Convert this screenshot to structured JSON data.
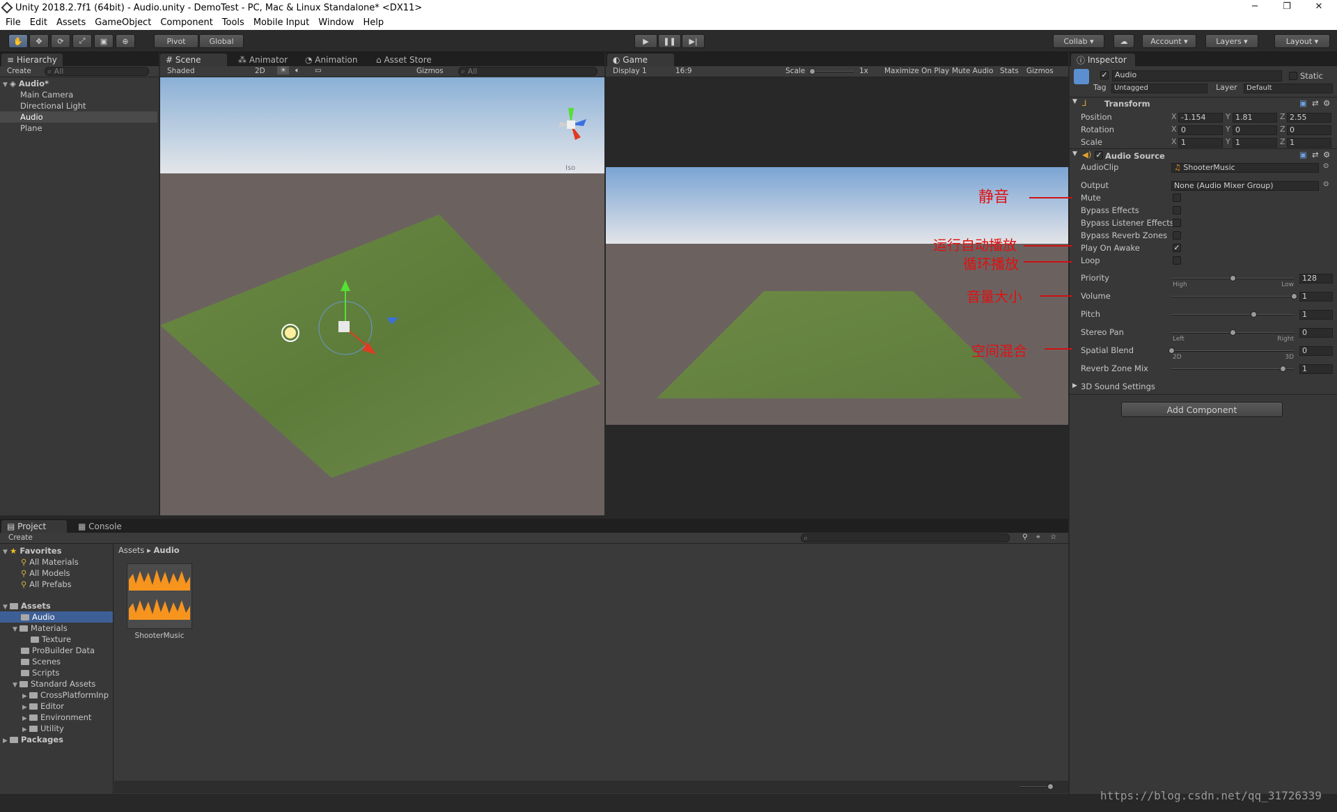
{
  "window": {
    "title": "Unity 2018.2.7f1 (64bit) - Audio.unity - DemoTest - PC, Mac & Linux Standalone* <DX11>",
    "minimize": "─",
    "restore": "❐",
    "close": "✕"
  },
  "menu": [
    "File",
    "Edit",
    "Assets",
    "GameObject",
    "Component",
    "Tools",
    "Mobile Input",
    "Window",
    "Help"
  ],
  "toolbar": {
    "pivot": "Pivot",
    "global": "Global",
    "collab": "Collab",
    "account": "Account",
    "layers": "Layers",
    "layout": "Layout"
  },
  "hierarchy": {
    "tab": "Hierarchy",
    "create": "Create",
    "search_placeholder": "All",
    "scene": "Audio*",
    "items": [
      "Main Camera",
      "Directional Light",
      "Audio",
      "Plane"
    ]
  },
  "scene": {
    "tabs": [
      "Scene",
      "Animator",
      "Animation",
      "Asset Store"
    ],
    "shading": "Shaded",
    "mode2d": "2D",
    "gizmos": "Gizmos",
    "search": "All",
    "persp": "Iso"
  },
  "game": {
    "tab": "Game",
    "display": "Display 1",
    "aspect": "16:9",
    "scale_label": "Scale",
    "scale_value": "1x",
    "maximize": "Maximize On Play",
    "mute": "Mute Audio",
    "stats": "Stats",
    "gizmos": "Gizmos"
  },
  "inspector": {
    "tab": "Inspector",
    "name": "Audio",
    "static": "Static",
    "tag_label": "Tag",
    "tag": "Untagged",
    "layer_label": "Layer",
    "layer": "Default",
    "transform": {
      "title": "Transform",
      "rows": [
        {
          "label": "Position",
          "x": "-1.154",
          "y": "1.81",
          "z": "2.55"
        },
        {
          "label": "Rotation",
          "x": "0",
          "y": "0",
          "z": "0"
        },
        {
          "label": "Scale",
          "x": "1",
          "y": "1",
          "z": "1"
        }
      ]
    },
    "audio": {
      "title": "Audio Source",
      "audioclip_label": "AudioClip",
      "audioclip": "ShooterMusic",
      "output_label": "Output",
      "output": "None (Audio Mixer Group)",
      "toggles": [
        {
          "label": "Mute",
          "checked": false
        },
        {
          "label": "Bypass Effects",
          "checked": false
        },
        {
          "label": "Bypass Listener Effects",
          "checked": false
        },
        {
          "label": "Bypass Reverb Zones",
          "checked": false
        },
        {
          "label": "Play On Awake",
          "checked": true
        },
        {
          "label": "Loop",
          "checked": false
        }
      ],
      "sliders": [
        {
          "label": "Priority",
          "value": "128",
          "frac": 0.5,
          "left": "High",
          "right": "Low"
        },
        {
          "label": "Volume",
          "value": "1",
          "frac": 1
        },
        {
          "label": "Pitch",
          "value": "1",
          "frac": 0.67
        },
        {
          "label": "Stereo Pan",
          "value": "0",
          "frac": 0.5,
          "left": "Left",
          "right": "Right"
        },
        {
          "label": "Spatial Blend",
          "value": "0",
          "frac": 0,
          "left": "2D",
          "right": "3D"
        },
        {
          "label": "Reverb Zone Mix",
          "value": "1",
          "frac": 0.91
        }
      ],
      "sound3d": "3D Sound Settings"
    },
    "add_component": "Add Component"
  },
  "annotations": [
    "静音",
    "运行自动播放",
    "循环播放",
    "音量大小",
    "空间混合"
  ],
  "project": {
    "tabs": [
      "Project",
      "Console"
    ],
    "create": "Create",
    "favorites": "Favorites",
    "fav_items": [
      "All Materials",
      "All Models",
      "All Prefabs"
    ],
    "assets": "Assets",
    "tree": [
      "Audio",
      "Materials",
      "Texture",
      "ProBuilder Data",
      "Scenes",
      "Scripts",
      "Standard Assets",
      "CrossPlatformInp",
      "Editor",
      "Environment",
      "Utility"
    ],
    "packages": "Packages",
    "breadcrumb": [
      "Assets",
      "Audio"
    ],
    "file": "ShooterMusic"
  },
  "watermark": "https://blog.csdn.net/qq_31726339"
}
